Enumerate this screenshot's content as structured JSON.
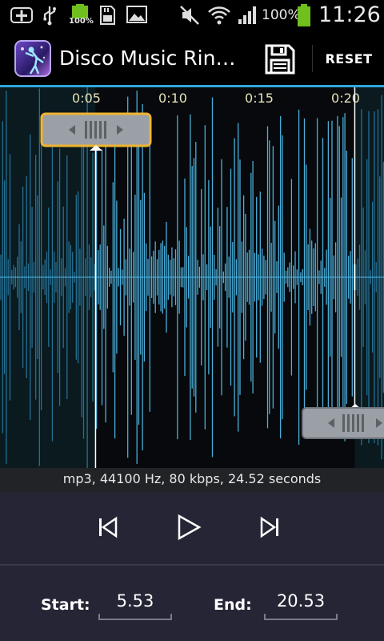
{
  "status_bar": {
    "battery_small_label": "100%",
    "battery_percent": "100%",
    "time": "11:26",
    "icons": [
      "add-icon",
      "usb-icon",
      "battery-small-icon",
      "sd-card-icon",
      "image-icon",
      "mute-icon",
      "wifi-icon",
      "signal-icon",
      "battery-icon"
    ]
  },
  "action_bar": {
    "title": "Disco Music Rin…",
    "reset_label": "RESET",
    "save_icon": "save-icon"
  },
  "timeline": {
    "ticks": [
      "0:05",
      "0:10",
      "0:15",
      "0:20"
    ]
  },
  "selection": {
    "start_seconds": 5.53,
    "end_seconds": 20.53,
    "total_seconds": 24.52
  },
  "info": {
    "text": "mp3, 44100 Hz, 80 kbps, 24.52 seconds"
  },
  "controls": {
    "prev_icon": "skip-previous-icon",
    "play_icon": "play-icon",
    "next_icon": "skip-next-icon"
  },
  "footer": {
    "start_label": "Start:",
    "start_value": "5.53",
    "end_label": "End:",
    "end_value": "20.53"
  },
  "colors": {
    "accent": "#2fa7d8",
    "wave_selected": "#4fb8e6",
    "wave_unselected": "#2a7fa8",
    "handle_active": "#f0b430",
    "controls_bg": "#262535"
  }
}
